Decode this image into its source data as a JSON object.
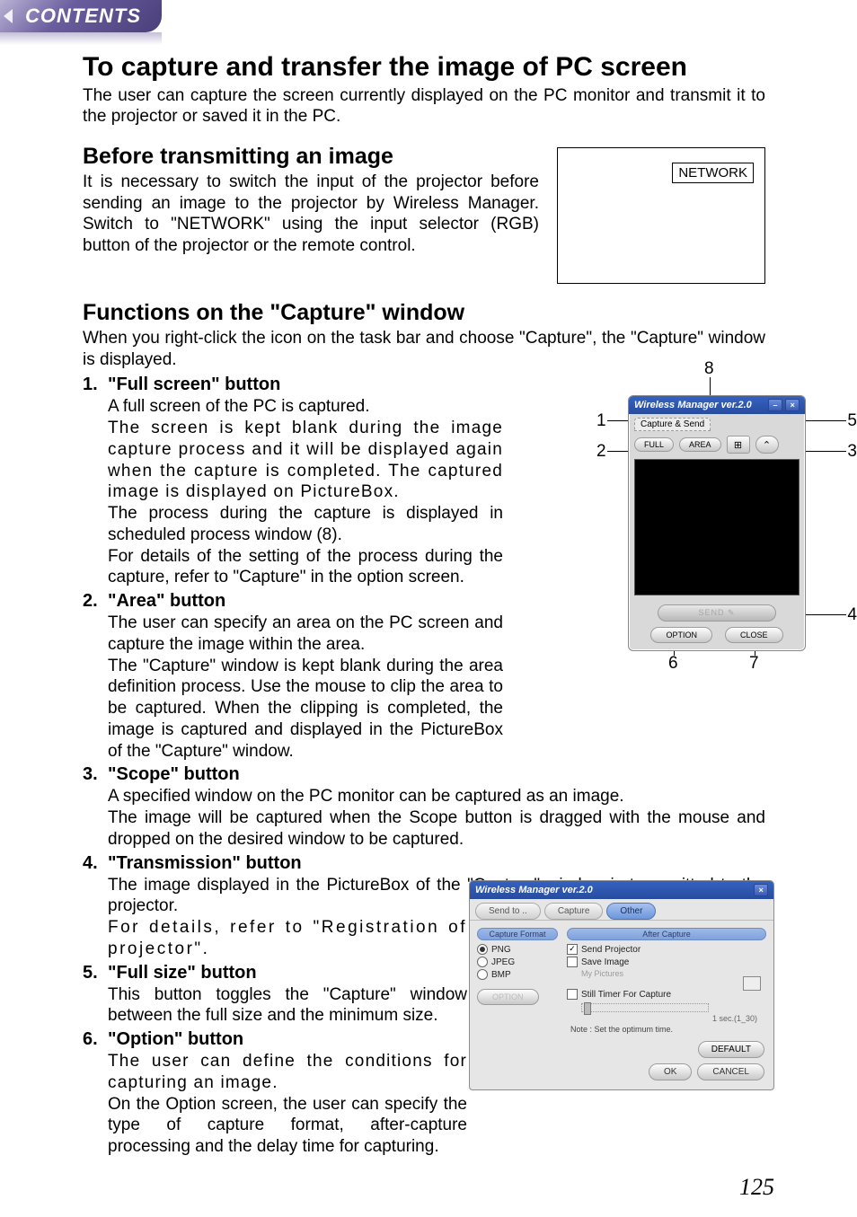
{
  "tab": {
    "label": "CONTENTS"
  },
  "h1": "To capture and transfer the image of PC screen",
  "intro": "The user can capture the screen currently displayed on the PC monitor and transmit it to the projector or saved it in the PC.",
  "before": {
    "heading": "Before transmitting an image",
    "text": "It is necessary to switch the input of the projector before sending an image to the projector by Wireless Manager. Switch to \"NETWORK\" using the input selector (RGB) button of the projector or the remote control."
  },
  "network_box": {
    "label": "NETWORK"
  },
  "functions": {
    "heading": "Functions on the \"Capture\" window",
    "intro": "When you right-click the icon on the task bar and choose \"Capture\", the \"Capture\" window is displayed.",
    "items": [
      {
        "num": "1.",
        "title": "\"Full screen\" button",
        "paras": [
          "A full screen of the PC is captured.",
          "The screen is kept blank during the image capture process and it will be displayed again when the capture is completed. The captured image is displayed on PictureBox.",
          "The process during the capture is displayed in scheduled process window (8).",
          "For details of the setting of the process during the capture, refer to \"Capture\" in the option screen."
        ]
      },
      {
        "num": "2.",
        "title": "\"Area\" button",
        "paras": [
          "The user can specify an area on the PC screen and capture the image within the area.",
          "The \"Capture\" window is kept blank during the area definition process. Use the mouse to clip the area to be captured. When the clipping is completed, the image is captured and displayed in the PictureBox of the \"Capture\" window."
        ]
      },
      {
        "num": "3.",
        "title": "\"Scope\" button",
        "paras": [
          "A specified window on the PC monitor can be captured as an image.",
          "The image will be captured when the Scope button is dragged with the mouse and dropped on the desired window to be captured."
        ]
      },
      {
        "num": "4.",
        "title": "\"Transmission\" button",
        "paras": [
          "The image displayed in the PictureBox of the \"Capture\" window is transmitted to the projector.",
          "For details, refer to \"Registration of projector\"."
        ]
      },
      {
        "num": "5.",
        "title": "\"Full size\" button",
        "paras": [
          "This button toggles the \"Capture\" window between the full size and the minimum size."
        ]
      },
      {
        "num": "6.",
        "title": "\"Option\" button",
        "paras": [
          "The user can define the conditions for capturing an image.",
          "On the Option screen, the user can specify the type of capture format, after-capture processing and the delay time for capturing."
        ]
      }
    ]
  },
  "capture_window": {
    "title": "Wireless Manager ver.2.0",
    "tab": "Capture & Send",
    "toolbar": {
      "full": "FULL",
      "area": "AREA",
      "scope": "⊞",
      "size": "⌃"
    },
    "send": "SEND",
    "option": "OPTION",
    "close": "CLOSE",
    "minimize": "–",
    "x": "×",
    "callouts": {
      "c1": "1",
      "c2": "2",
      "c3": "3",
      "c4": "4",
      "c5": "5",
      "c6": "6",
      "c7": "7",
      "c8": "8"
    }
  },
  "option_window": {
    "title": "Wireless Manager ver.2.0",
    "x": "×",
    "tabs": {
      "sendto": "Send to ..",
      "capture": "Capture",
      "other": "Other"
    },
    "left": {
      "group": "Capture Format",
      "png": "PNG",
      "jpeg": "JPEG",
      "bmp": "BMP",
      "option": "OPTION"
    },
    "right": {
      "group": "After Capture",
      "send_projector": "Send Projector",
      "save_image": "Save Image",
      "save_sub": "My Pictures",
      "still_timer": "Still Timer For Capture",
      "timer_hint": "1 sec.(1_30)",
      "note": "Note :  Set the optimum time."
    },
    "buttons": {
      "default": "DEFAULT",
      "ok": "OK",
      "cancel": "CANCEL"
    }
  },
  "page_number": "125"
}
